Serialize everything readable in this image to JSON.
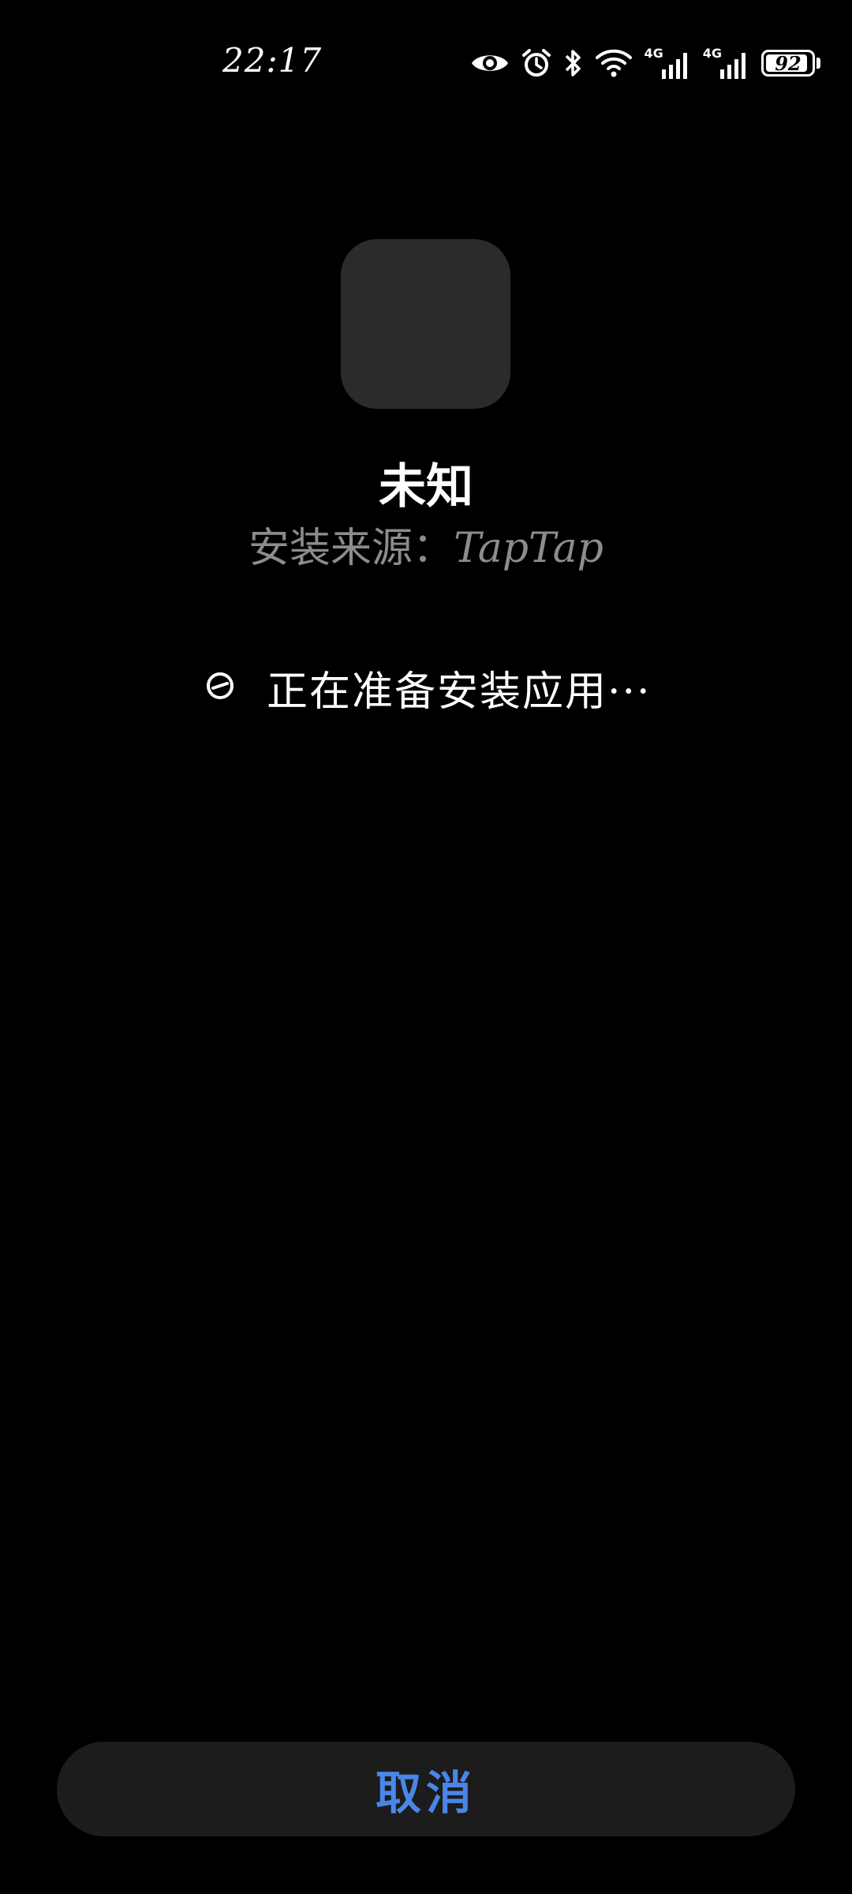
{
  "status_bar": {
    "time": "22:17",
    "network_1": "4G",
    "network_2": "4G",
    "battery_level": "92",
    "battery_fraction": 0.92,
    "icons": [
      "eye-icon",
      "alarm-icon",
      "bluetooth-icon",
      "wifi-icon",
      "signal-icon",
      "signal-icon",
      "battery-icon"
    ]
  },
  "app": {
    "name": "未知",
    "source_label": "安装来源：",
    "source_value": "TapTap",
    "icon_color": "#2b2b2b"
  },
  "progress": {
    "text": "正在准备安装应用···",
    "icon": "loading-spinner-icon"
  },
  "actions": {
    "cancel_label": "取消",
    "cancel_color": "#4a86e8"
  }
}
